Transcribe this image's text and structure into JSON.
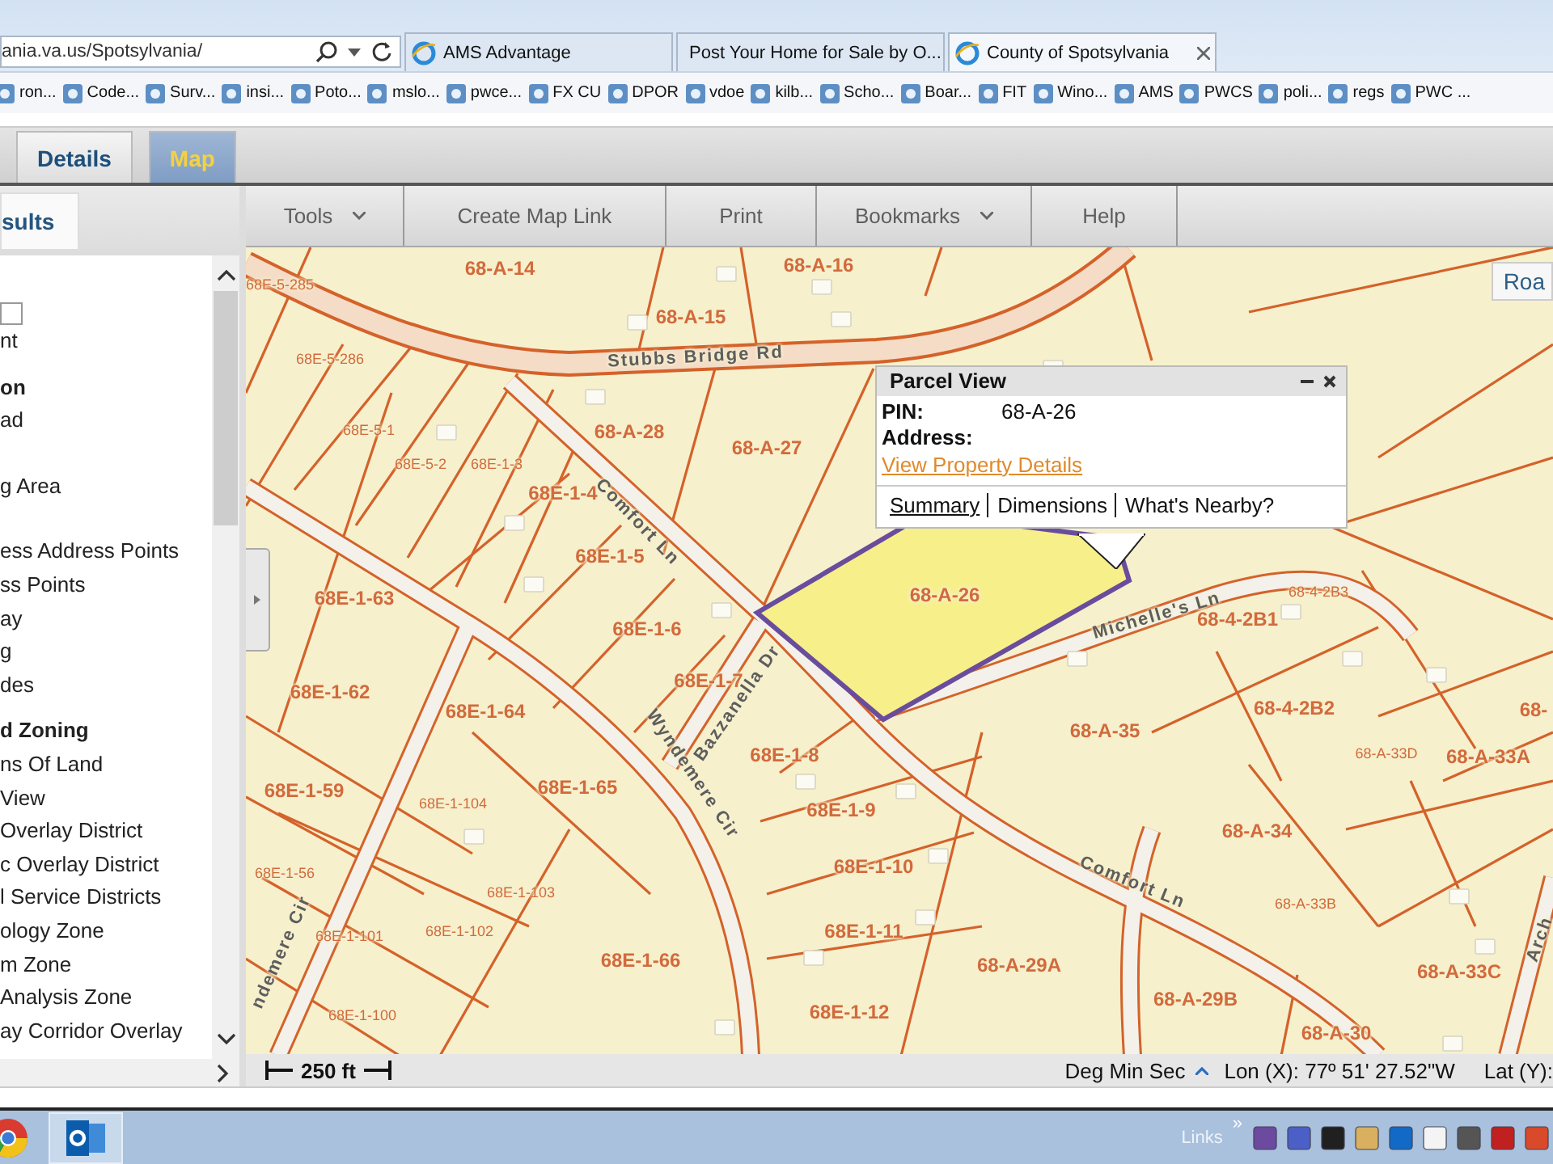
{
  "browser": {
    "address": "ania.va.us/Spotsylvania/",
    "tabs": [
      {
        "title": "AMS Advantage",
        "kind": "globe",
        "selected": false
      },
      {
        "title": "Post Your Home for Sale by O...",
        "kind": "house",
        "selected": false
      },
      {
        "title": "County of Spotsylvania",
        "kind": "globe",
        "selected": true
      }
    ],
    "favorites": [
      "ron...",
      "Code...",
      "Surv...",
      "insi...",
      "Poto...",
      "mslo...",
      "pwce...",
      "FX CU",
      "DPOR",
      "vdoe",
      "kilb...",
      "Scho...",
      "Boar...",
      "FIT",
      "Wino...",
      "AMS",
      "PWCS",
      "poli...",
      "regs",
      "PWC ..."
    ]
  },
  "app_tabs": [
    {
      "label": "Details",
      "selected": false
    },
    {
      "label": "Map",
      "selected": true
    }
  ],
  "side_panel": {
    "tab": "sults",
    "items": [
      {
        "kind": "field"
      },
      {
        "kind": "text",
        "text": "nt"
      },
      {
        "kind": "heading",
        "text": "on"
      },
      {
        "kind": "text",
        "text": "ad"
      },
      {
        "kind": "text",
        "text": "g Area",
        "space_before": true
      },
      {
        "kind": "text",
        "text": "ess Address Points",
        "space_before": true
      },
      {
        "kind": "text",
        "text": "ss Points"
      },
      {
        "kind": "text",
        "text": "ay"
      },
      {
        "kind": "text",
        "text": "g"
      },
      {
        "kind": "text",
        "text": "des"
      },
      {
        "kind": "heading",
        "text": "d Zoning"
      },
      {
        "kind": "text",
        "text": "ns Of Land"
      },
      {
        "kind": "text",
        "text": "View"
      },
      {
        "kind": "text",
        "text": "Overlay District"
      },
      {
        "kind": "text",
        "text": "c Overlay District"
      },
      {
        "kind": "text",
        "text": "l Service Districts"
      },
      {
        "kind": "text",
        "text": "ology Zone"
      },
      {
        "kind": "text",
        "text": "m Zone"
      },
      {
        "kind": "text",
        "text": "Analysis Zone"
      },
      {
        "kind": "text",
        "text": "ay Corridor Overlay"
      }
    ]
  },
  "toolbar": [
    {
      "label": "Tools",
      "menu": true
    },
    {
      "label": "Create Map Link",
      "menu": false
    },
    {
      "label": "Print",
      "menu": false
    },
    {
      "label": "Bookmarks",
      "menu": true
    },
    {
      "label": "Help",
      "menu": false
    }
  ],
  "map": {
    "basemap_button": "Roa",
    "labels": [
      {
        "text": "68E-5-285",
        "kind": "small"
      },
      {
        "text": "68-A-14",
        "kind": "parcel"
      },
      {
        "text": "68-A-15",
        "kind": "parcel"
      },
      {
        "text": "68-A-16",
        "kind": "parcel"
      },
      {
        "text": "68E-5-286",
        "kind": "small"
      },
      {
        "text": "68E-5-1",
        "kind": "small"
      },
      {
        "text": "68-A-28",
        "kind": "parcel"
      },
      {
        "text": "68-A-27",
        "kind": "parcel"
      },
      {
        "text": "68E-5-2",
        "kind": "small"
      },
      {
        "text": "68E-1-3",
        "kind": "small"
      },
      {
        "text": "68E-1-4",
        "kind": "parcel"
      },
      {
        "text": "68E-1-5",
        "kind": "parcel"
      },
      {
        "text": "68E-1-63",
        "kind": "parcel"
      },
      {
        "text": "68E-1-6",
        "kind": "parcel"
      },
      {
        "text": "68E-1-7",
        "kind": "parcel"
      },
      {
        "text": "68E-1-62",
        "kind": "parcel"
      },
      {
        "text": "68E-1-64",
        "kind": "parcel"
      },
      {
        "text": "68-A-26",
        "kind": "parcel"
      },
      {
        "text": "68-4-2B1",
        "kind": "parcel"
      },
      {
        "text": "68-4-2B3",
        "kind": "small"
      },
      {
        "text": "68-4-2B2",
        "kind": "parcel"
      },
      {
        "text": "68-A-35",
        "kind": "parcel"
      },
      {
        "text": "68E-1-8",
        "kind": "parcel"
      },
      {
        "text": "68-A-33D",
        "kind": "small"
      },
      {
        "text": "68-A-33A",
        "kind": "parcel"
      },
      {
        "text": "68E-1-59",
        "kind": "parcel"
      },
      {
        "text": "68E-1-104",
        "kind": "small"
      },
      {
        "text": "68E-1-65",
        "kind": "parcel"
      },
      {
        "text": "68E-1-9",
        "kind": "parcel"
      },
      {
        "text": "68-A-34",
        "kind": "parcel"
      },
      {
        "text": "68E-1-56",
        "kind": "small"
      },
      {
        "text": "68E-1-103",
        "kind": "small"
      },
      {
        "text": "68E-1-10",
        "kind": "parcel"
      },
      {
        "text": "68-A-33B",
        "kind": "small"
      },
      {
        "text": "68E-1-101",
        "kind": "small"
      },
      {
        "text": "68E-1-102",
        "kind": "small"
      },
      {
        "text": "68E-1-66",
        "kind": "parcel"
      },
      {
        "text": "68E-1-11",
        "kind": "parcel"
      },
      {
        "text": "68-A-29A",
        "kind": "parcel"
      },
      {
        "text": "68-A-33C",
        "kind": "parcel"
      },
      {
        "text": "68E-1-100",
        "kind": "small"
      },
      {
        "text": "68E-1-12",
        "kind": "parcel"
      },
      {
        "text": "68-A-29B",
        "kind": "parcel"
      },
      {
        "text": "68-A-30",
        "kind": "parcel"
      },
      {
        "text": "68-",
        "kind": "parcel"
      },
      {
        "text": "Stubbs Bridge Rd",
        "kind": "road"
      },
      {
        "text": "Comfort Ln",
        "kind": "road"
      },
      {
        "text": "Bazzanella Dr",
        "kind": "road"
      },
      {
        "text": "Michelle's Ln",
        "kind": "road"
      },
      {
        "text": "Wyndemere Cir",
        "kind": "road"
      },
      {
        "text": "ndemere Cir",
        "kind": "road"
      },
      {
        "text": "Comfort Ln",
        "kind": "road"
      },
      {
        "text": "Arch",
        "kind": "road"
      }
    ],
    "popup": {
      "title": "Parcel View",
      "fields": [
        {
          "label": "PIN:",
          "value": "68-A-26"
        },
        {
          "label": "Address:"
        }
      ],
      "link": "View Property Details",
      "tabs": [
        {
          "label": "Summary",
          "selected": true
        },
        {
          "label": "Dimensions",
          "selected": false
        },
        {
          "label": "What's Nearby?",
          "selected": false
        }
      ]
    }
  },
  "status_bar": {
    "scale": "250 ft",
    "units": "Deg Min Sec",
    "lon": "Lon (X): 77º 51' 27.52\"W",
    "lat": "Lat (Y):"
  },
  "taskbar": {
    "links": "Links",
    "chevron": "»"
  }
}
